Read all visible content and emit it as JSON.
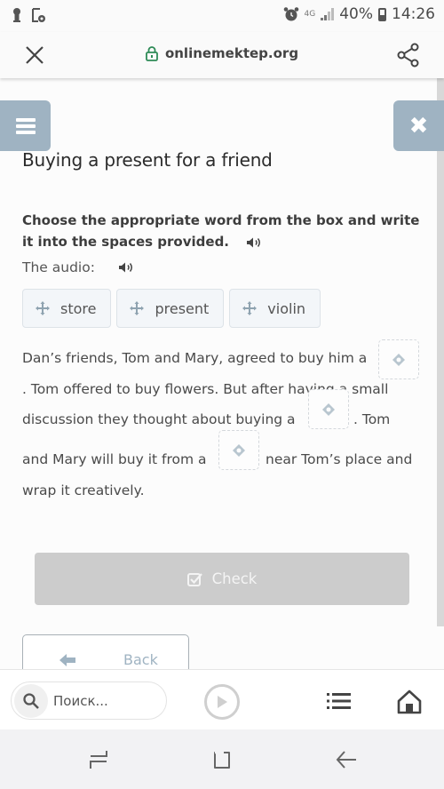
{
  "status_bar": {
    "network": "4G",
    "battery": "40%",
    "time": "14:26"
  },
  "browser": {
    "url": "onlinemektep.org",
    "secure": true
  },
  "lesson": {
    "title": "Buying a present for a friend",
    "instruction": "Choose the appropriate word from the box and write it into the spaces provided.",
    "audio_label": "The audio:",
    "word_bank": [
      "store",
      "present",
      "violin"
    ],
    "passage": {
      "line1": "Dan’s friends, Tom and Mary, agreed to buy him a",
      "line2": ". Tom offered to buy flowers. But after having a small",
      "line3a": "discussion they thought about buying a",
      "line3b": ". Tom",
      "line4a": "and Mary will buy it from a",
      "line4b": "near Tom’s place and",
      "line5": "wrap it creatively."
    },
    "blanks": [
      "",
      "",
      ""
    ],
    "check_label": "Check",
    "back_label": "Back"
  },
  "toolbar": {
    "search_placeholder": "Поиск..."
  },
  "colors": {
    "accent": "#9fb3c2",
    "check_disabled": "#cccccc",
    "secure_lock": "#2e8b57"
  }
}
